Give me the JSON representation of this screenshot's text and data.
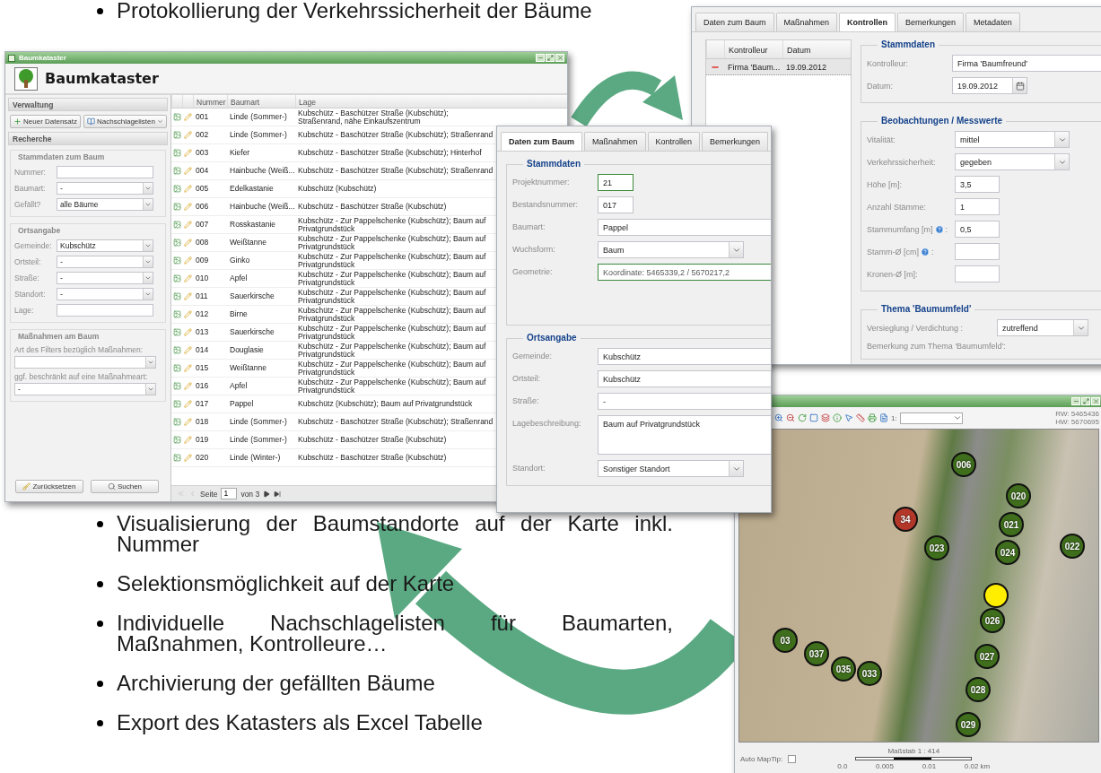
{
  "top_bullets": [
    "Protokollierung der Verkehrssicherheit der Bäume"
  ],
  "main_window": {
    "title": "Baumkataster",
    "header": "Baumkataster",
    "sidebar": {
      "admin_title": "Verwaltung",
      "admin_buttons": [
        {
          "label": "Neuer Datensatz",
          "menu": false
        },
        {
          "label": "Nachschlagelisten",
          "menu": true
        }
      ],
      "search_title": "Recherche",
      "groups": [
        {
          "title": "Stammdaten zum Baum",
          "kind": "inline",
          "fields": [
            {
              "label": "Nummer:",
              "kind": "text"
            },
            {
              "label": "Baumart:",
              "kind": "select",
              "value": "-"
            },
            {
              "label": "Gefällt?",
              "kind": "select",
              "value": "alle Bäume"
            }
          ]
        },
        {
          "title": "Ortsangabe",
          "kind": "inline",
          "fields": [
            {
              "label": "Gemeinde:",
              "kind": "select",
              "value": "Kubschütz"
            },
            {
              "label": "Ortsteil:",
              "kind": "select",
              "value": "-"
            },
            {
              "label": "Straße:",
              "kind": "select",
              "value": "-"
            },
            {
              "label": "Standort:",
              "kind": "select",
              "value": "-"
            },
            {
              "label": "Lage:",
              "kind": "text"
            }
          ]
        },
        {
          "title": "Maßnahmen am Baum",
          "kind": "stacked",
          "fields": [
            {
              "label": "Art des Filters bezüglich Maßnahmen:",
              "kind": "select"
            },
            {
              "label": "ggf. beschränkt auf eine Maßnahmeart:",
              "kind": "select",
              "value": "-"
            }
          ]
        }
      ],
      "footer_buttons": [
        "Zurücksetzen",
        "Suchen"
      ]
    },
    "grid": {
      "columns": [
        "Nummer",
        "Baumart",
        "Lage"
      ],
      "rows": [
        [
          "001",
          "Linde (Sommer-)",
          "Kubschütz - Baschützer Straße (Kubschütz); Straßenrand, nähe Einkaufszentrum"
        ],
        [
          "002",
          "Linde (Sommer-)",
          "Kubschütz - Baschützer Straße (Kubschütz); Straßenrand"
        ],
        [
          "003",
          "Kiefer",
          "Kubschütz - Baschützer Straße (Kubschütz); Hinterhof"
        ],
        [
          "004",
          "Hainbuche (Weiß...",
          "Kubschütz - Baschützer Straße (Kubschütz); Straßenrand"
        ],
        [
          "005",
          "Edelkastanie",
          "Kubschütz (Kubschütz)"
        ],
        [
          "006",
          "Hainbuche (Weiß...",
          "Kubschütz - Baschützer Straße (Kubschütz)"
        ],
        [
          "007",
          "Rosskastanie",
          "Kubschütz - Zur Pappelschenke (Kubschütz); Baum auf Privatgrundstück"
        ],
        [
          "008",
          "Weißtanne",
          "Kubschütz - Zur Pappelschenke (Kubschütz); Baum auf Privatgrundstück"
        ],
        [
          "009",
          "Ginko",
          "Kubschütz - Zur Pappelschenke (Kubschütz); Baum auf Privatgrundstück"
        ],
        [
          "010",
          "Apfel",
          "Kubschütz - Zur Pappelschenke (Kubschütz); Baum auf Privatgrundstück"
        ],
        [
          "011",
          "Sauerkirsche",
          "Kubschütz - Zur Pappelschenke (Kubschütz); Baum auf Privatgrundstück"
        ],
        [
          "012",
          "Birne",
          "Kubschütz - Zur Pappelschenke (Kubschütz); Baum auf Privatgrundstück"
        ],
        [
          "013",
          "Sauerkirsche",
          "Kubschütz - Zur Pappelschenke (Kubschütz); Baum auf Privatgrundstück"
        ],
        [
          "014",
          "Douglasie",
          "Kubschütz - Zur Pappelschenke (Kubschütz); Baum auf Privatgrundstück"
        ],
        [
          "015",
          "Weißtanne",
          "Kubschütz - Zur Pappelschenke (Kubschütz); Baum auf Privatgrundstück"
        ],
        [
          "016",
          "Apfel",
          "Kubschütz - Zur Pappelschenke (Kubschütz); Baum auf Privatgrundstück"
        ],
        [
          "017",
          "Pappel",
          "Kubschütz (Kubschütz); Baum auf Privatgrundstück"
        ],
        [
          "018",
          "Linde (Sommer-)",
          "Kubschütz - Baschützer Straße (Kubschütz); Straßenrand"
        ],
        [
          "019",
          "Linde (Sommer-)",
          "Kubschütz - Baschützer Straße (Kubschütz)"
        ],
        [
          "020",
          "Linde (Winter-)",
          "Kubschütz - Baschützer Straße (Kubschütz)"
        ]
      ],
      "pager": {
        "page_label": "Seite",
        "page": "1",
        "of": "von 3"
      }
    }
  },
  "form_window": {
    "tabs": [
      {
        "label": "Daten zum Baum",
        "selected": true
      },
      {
        "label": "Maßnahmen",
        "selected": false
      },
      {
        "label": "Kontrollen",
        "selected": false
      },
      {
        "label": "Bemerkungen",
        "selected": false
      }
    ],
    "fieldsets": [
      {
        "title": "Stammdaten",
        "fields": [
          {
            "label": "Projektnummer:",
            "kind": "short",
            "value": "21",
            "valid": true
          },
          {
            "label": "Bestandsnummer:",
            "kind": "short",
            "value": "017",
            "valid": false
          },
          {
            "label": "Baumart:",
            "kind": "text",
            "value": "Pappel",
            "valid": false
          },
          {
            "label": "Wuchsform:",
            "kind": "select",
            "value": "Baum",
            "valid": false
          },
          {
            "label": "Geometrie:",
            "kind": "readonly",
            "value": "Koordinate: 5465339,2 / 5670217,2",
            "valid": true
          }
        ]
      },
      {
        "title": "Ortsangabe",
        "fields": [
          {
            "label": "Gemeinde:",
            "kind": "text",
            "value": "Kubschütz",
            "valid": false
          },
          {
            "label": "Ortsteil:",
            "kind": "text",
            "value": "Kubschütz",
            "valid": false
          },
          {
            "label": "Straße:",
            "kind": "text",
            "value": "-",
            "valid": false
          },
          {
            "label": "Lagebeschreibung:",
            "kind": "textarea",
            "value": "Baum auf Privatgrundstück",
            "valid": false
          },
          {
            "label": "Standort:",
            "kind": "select",
            "value": "Sonstiger Standort",
            "valid": false
          }
        ]
      }
    ]
  },
  "control_window": {
    "tabs": [
      {
        "label": "Daten zum Baum",
        "selected": false
      },
      {
        "label": "Maßnahmen",
        "selected": false
      },
      {
        "label": "Kontrollen",
        "selected": true
      },
      {
        "label": "Bemerkungen",
        "selected": false
      },
      {
        "label": "Metadaten",
        "selected": false
      }
    ],
    "list": {
      "columns": [
        "Kontrolleur",
        "Datum"
      ],
      "rows": [
        {
          "cells": [
            "Firma 'Baum...",
            "19.09.2012"
          ],
          "selected": true
        }
      ]
    },
    "fieldsets": [
      {
        "title": "Stammdaten",
        "fields": [
          {
            "label": "Kontrolleur:",
            "kind": "text",
            "value": "Firma 'Baumfreund'"
          },
          {
            "label": "Datum:",
            "kind": "date",
            "value": "19.09.2012"
          }
        ]
      },
      {
        "title": "Beobachtungen / Messwerte",
        "fields": [
          {
            "label": "Vitalität:",
            "kind": "select",
            "value": "mittel"
          },
          {
            "label": "Verkehrssicherheit:",
            "kind": "select",
            "value": "gegeben"
          },
          {
            "label": "Höhe [m]:",
            "kind": "short",
            "value": "3,5"
          },
          {
            "label": "Anzahl Stämme:",
            "kind": "short",
            "value": "1"
          },
          {
            "label": "Stammumfang [m]",
            "kind": "short",
            "value": "0,5",
            "help": true,
            "label_tail": ":"
          },
          {
            "label": "Stamm-Ø [cm]",
            "kind": "short",
            "help": true,
            "label_tail": ":"
          },
          {
            "label": "Kronen-Ø [m]:",
            "kind": "short",
            "help": false
          }
        ]
      },
      {
        "title": "Thema 'Baumumfeld'",
        "fields": [
          {
            "label": "Versieglung / Verdichtung :",
            "kind": "select",
            "value": "zutreffend"
          },
          {
            "label": "Bemerkung zum Thema 'Baumumfeld':",
            "kind": "label"
          }
        ]
      }
    ]
  },
  "map_window": {
    "scale_prefix": "1:",
    "coordinates": [
      "RW: 5465436",
      "HW: 5670695"
    ],
    "markers": [
      {
        "label": "006",
        "kind": "tree"
      },
      {
        "label": "020",
        "kind": "tree"
      },
      {
        "label": "34",
        "kind": "felled"
      },
      {
        "label": "021",
        "kind": "tree"
      },
      {
        "label": "023",
        "kind": "tree"
      },
      {
        "label": "024",
        "kind": "tree"
      },
      {
        "label": "022",
        "kind": "tree"
      },
      {
        "kind": "selected"
      },
      {
        "label": "026",
        "kind": "tree"
      },
      {
        "label": "03",
        "kind": "tree"
      },
      {
        "label": "037",
        "kind": "tree"
      },
      {
        "label": "035",
        "kind": "tree"
      },
      {
        "label": "033",
        "kind": "tree"
      },
      {
        "label": "027",
        "kind": "tree"
      },
      {
        "label": "028",
        "kind": "tree"
      },
      {
        "label": "029",
        "kind": "tree"
      }
    ],
    "maptip_label": "Auto MapTip:",
    "maptip_checked": false,
    "scale_title": "Maßstab 1 : 414",
    "scale_ticks": [
      "0.0",
      "0.005",
      "0.01",
      "0.02 km"
    ]
  },
  "bottom_bullets": [
    "Visualisierung der Baumstandorte auf der Karte inkl. Nummer",
    "Selektionsmöglichkeit auf der Karte",
    "Individuelle Nachschlagelisten für Baumarten, Maßnahmen, Kontrolleure…",
    "Archivierung der gefällten Bäume",
    "Export des Katasters als Excel Tabelle"
  ]
}
